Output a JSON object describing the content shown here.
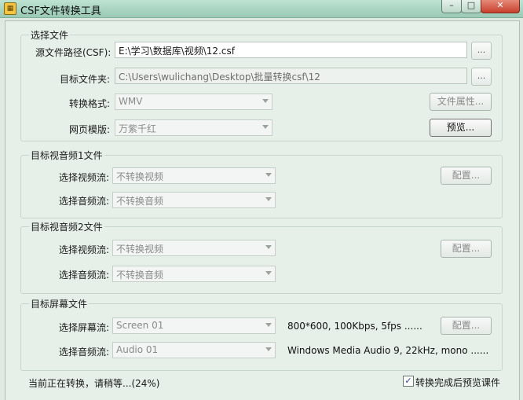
{
  "window": {
    "title": "CSF文件转换工具",
    "icon": "app-icon",
    "min": "–",
    "max": "□",
    "close": "✕"
  },
  "select_file": {
    "group_title": "选择文件",
    "source_label": "源文件路径(CSF):",
    "source_value": "E:\\学习\\数据库\\视频\\12.csf",
    "target_label": "目标文件夹:",
    "target_value": "C:\\Users\\wulichang\\Desktop\\批量转换csf\\12",
    "browse_label": "...",
    "format_label": "转换格式:",
    "format_value": "WMV",
    "file_props_button": "文件属性...",
    "template_label": "网页模版:",
    "template_value": "万紫千红",
    "preview_button": "预览..."
  },
  "av1": {
    "group_title": "目标视音频1文件",
    "video_label": "选择视频流:",
    "video_value": "不转换视频",
    "audio_label": "选择音频流:",
    "audio_value": "不转换音频",
    "config_button": "配置..."
  },
  "av2": {
    "group_title": "目标视音频2文件",
    "video_label": "选择视频流:",
    "video_value": "不转换视频",
    "audio_label": "选择音频流:",
    "audio_value": "不转换音频",
    "config_button": "配置..."
  },
  "screen": {
    "group_title": "目标屏幕文件",
    "screen_label": "选择屏幕流:",
    "screen_value": "Screen 01",
    "screen_info": "800*600, 100Kbps, 5fps ......",
    "audio_label": "选择音频流:",
    "audio_value": "Audio 01",
    "audio_info": "Windows Media Audio 9, 22kHz, mono ......",
    "config_button": "配置..."
  },
  "footer": {
    "status": "当前正在转换，请稍等...(24%)",
    "progress_percent": 24,
    "preview_after_label": "转换完成后预览课件",
    "preview_after_checked": true,
    "check_mark": "✓"
  }
}
